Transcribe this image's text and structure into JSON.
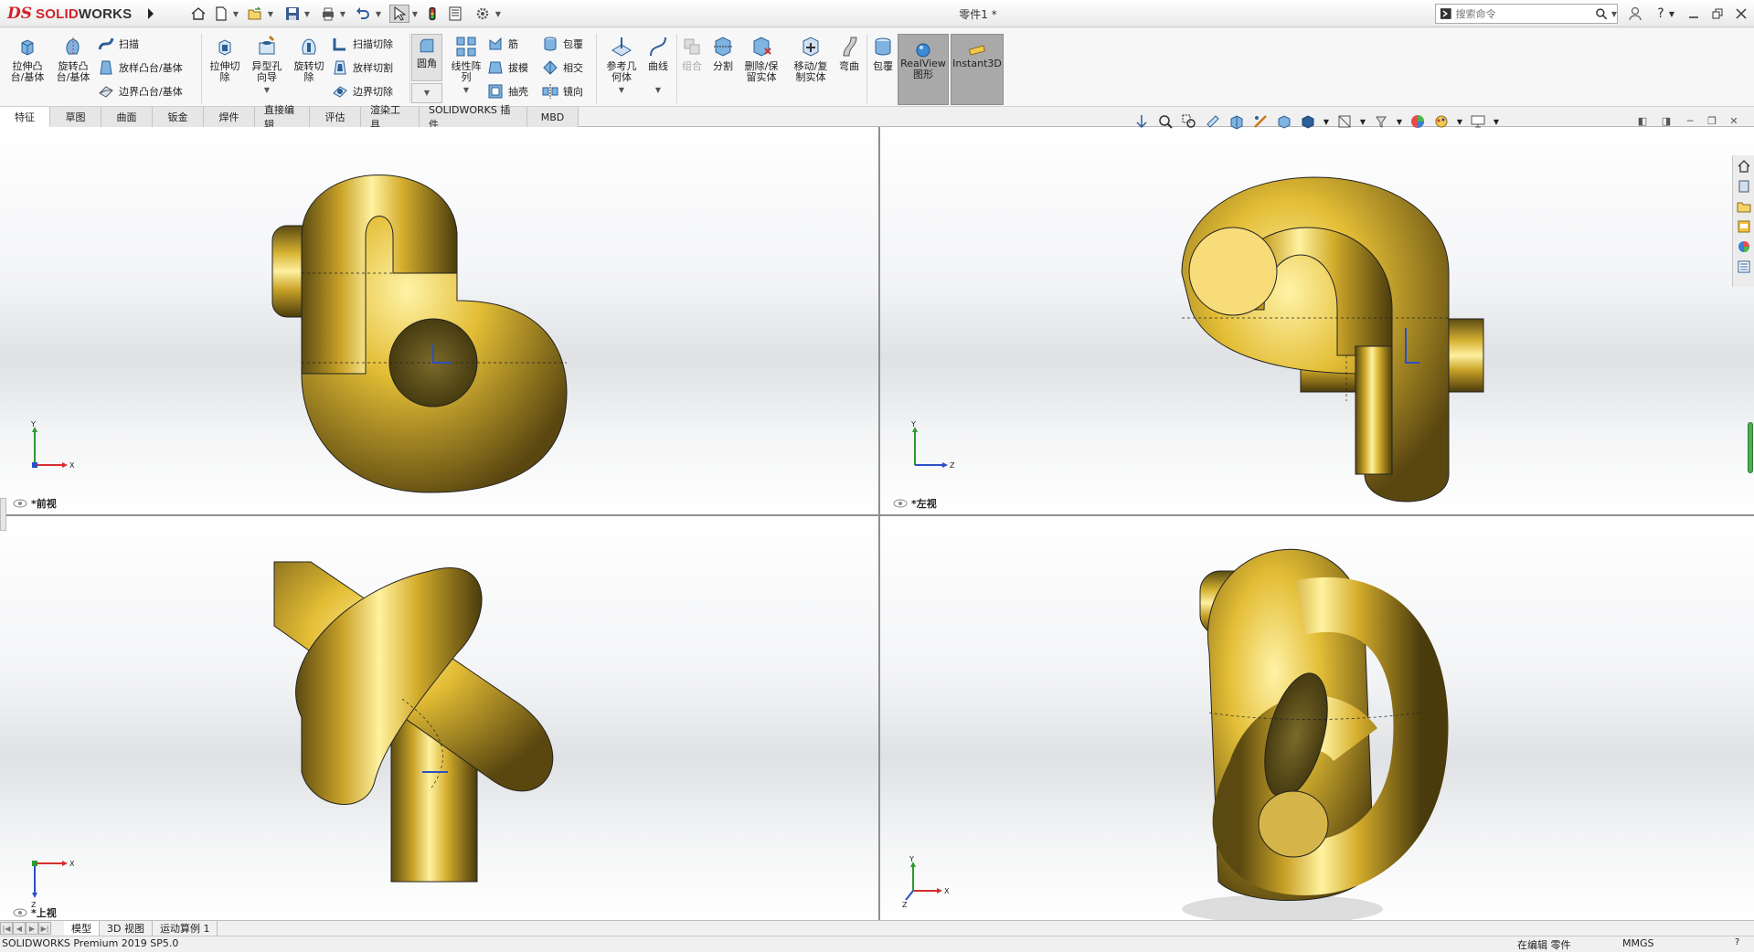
{
  "app": {
    "logo_prefix": "DS",
    "logo_brand_a": "SOLID",
    "logo_brand_b": "WORKS",
    "document_title": "零件1 *",
    "search_placeholder": "搜索命令",
    "brand_color": "#d2232a"
  },
  "quick_access": [
    {
      "name": "home-icon"
    },
    {
      "name": "new-document-icon"
    },
    {
      "name": "open-folder-icon"
    },
    {
      "name": "save-icon"
    },
    {
      "name": "print-icon"
    },
    {
      "name": "undo-icon"
    },
    {
      "name": "select-pointer-icon"
    },
    {
      "name": "rebuild-icon"
    },
    {
      "name": "file-properties-icon"
    },
    {
      "name": "options-gear-icon"
    }
  ],
  "ribbon": {
    "extrude_boss": "拉伸凸\n台/基体",
    "revolve_boss": "旋转凸\n台/基体",
    "sweep": "扫描",
    "loft": "放样凸台/基体",
    "boundary_boss": "边界凸台/基体",
    "extrude_cut": "拉伸切\n除",
    "hole_wizard": "异型孔\n向导",
    "revolve_cut": "旋转切\n除",
    "swept_cut": "扫描切除",
    "lofted_cut": "放样切割",
    "boundary_cut": "边界切除",
    "fillet": "圆角",
    "linear_pattern": "线性阵\n列",
    "rib": "筋",
    "draft": "拔模",
    "shell": "抽壳",
    "wrap": "包覆",
    "intersect": "相交",
    "mirror": "镜向",
    "reference_geometry": "参考几\n何体",
    "curves": "曲线",
    "combine": "组合",
    "split": "分割",
    "delete_keep_body": "删除/保\n留实体",
    "move_copy_body": "移动/复\n制实体",
    "flex": "弯曲",
    "wrap2": "包覆",
    "realview": "RealView\n图形",
    "instant3d": "Instant3D"
  },
  "command_tabs": [
    "特征",
    "草图",
    "曲面",
    "钣金",
    "焊件",
    "直接编辑",
    "评估",
    "渲染工具",
    "SOLIDWORKS 插件",
    "MBD"
  ],
  "viewports": {
    "front_label": "*前视",
    "left_label": "*左视",
    "top_label": "*上视",
    "front_triad": {
      "up": "Y",
      "right": "X"
    },
    "left_triad": {
      "up": "Y",
      "right": "Z"
    },
    "top_triad": {
      "down": "Z",
      "right": "X"
    },
    "iso_triad": {
      "up": "Y",
      "right": "X",
      "diag": "Z"
    }
  },
  "bottom_tabs": [
    "模型",
    "3D 视图",
    "运动算例 1"
  ],
  "status": {
    "product": "SOLIDWORKS Premium 2019 SP5.0",
    "editing": "在编辑 零件",
    "units": "MMGS",
    "help": "?"
  }
}
